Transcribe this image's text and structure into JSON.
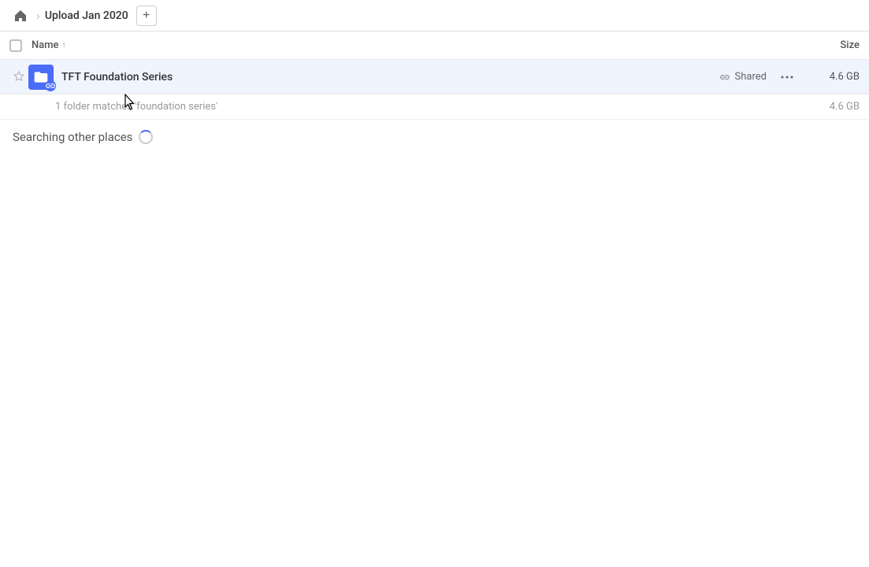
{
  "header": {
    "home_label": "Home",
    "breadcrumb": "Upload Jan 2020",
    "add_button_label": "+"
  },
  "columns": {
    "name_label": "Name",
    "size_label": "Size",
    "sort_direction": "asc"
  },
  "file_row": {
    "name": "TFT Foundation Series",
    "shared_label": "Shared",
    "size": "4.6 GB",
    "is_starred": false
  },
  "summary": {
    "text": "1 folder matches 'foundation series'",
    "size": "4.6 GB"
  },
  "searching": {
    "label": "Searching other places"
  },
  "icons": {
    "home": "⌂",
    "star_empty": "☆",
    "more": "···",
    "link": "🔗",
    "sort_asc": "↑",
    "checkbox_empty": "☐"
  }
}
